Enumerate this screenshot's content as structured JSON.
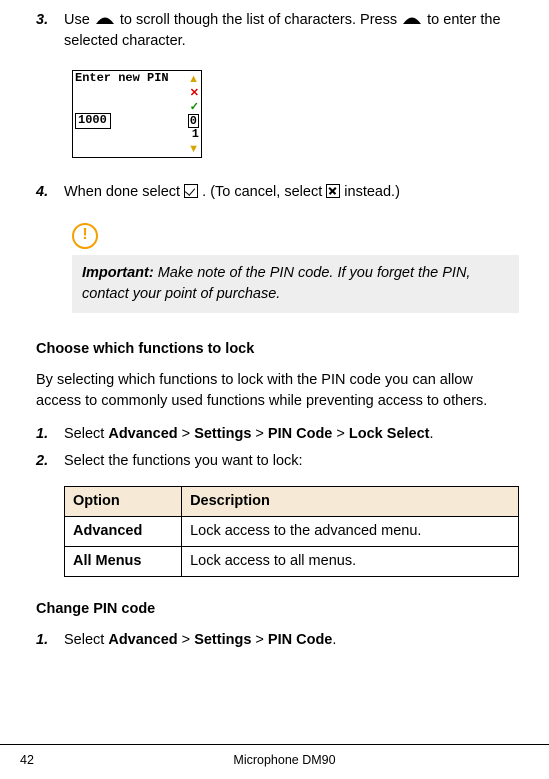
{
  "step3": {
    "num": "3.",
    "text_a": "Use ",
    "text_b": " to scroll though the list of characters. Press ",
    "text_c": " to enter the selected character."
  },
  "pin_screen": {
    "title": "Enter new PIN",
    "value": "1000",
    "sel": "0",
    "below": "1"
  },
  "step4": {
    "num": "4.",
    "text_a": "When done select ",
    "text_b": ". (To cancel, select ",
    "text_c": " instead.)"
  },
  "important": {
    "label": "Important:",
    "text": "  Make note of the PIN code. If you forget the PIN, contact your point of purchase."
  },
  "choose": {
    "heading": "Choose which functions to lock",
    "para": "By selecting which functions to lock with the PIN code you can allow access to commonly used functions while preventing access to others.",
    "s1": {
      "num": "1.",
      "a": "Select ",
      "b": "Advanced",
      "c": " > ",
      "d": "Settings",
      "e": " > ",
      "f": "PIN Code",
      "g": " > ",
      "h": "Lock Select",
      "i": "."
    },
    "s2": {
      "num": "2.",
      "text": "Select the functions you want to lock:"
    }
  },
  "table": {
    "h1": "Option",
    "h2": "Description",
    "r1c1": "Advanced",
    "r1c2": "Lock access to the advanced menu.",
    "r2c1": "All Menus",
    "r2c2": "Lock access to all menus."
  },
  "change": {
    "heading": "Change PIN code",
    "s1": {
      "num": "1.",
      "a": "Select ",
      "b": "Advanced",
      "c": " > ",
      "d": "Settings",
      "e": " > ",
      "f": "PIN Code",
      "g": "."
    }
  },
  "footer": {
    "page": "42",
    "title": "Microphone DM90"
  }
}
